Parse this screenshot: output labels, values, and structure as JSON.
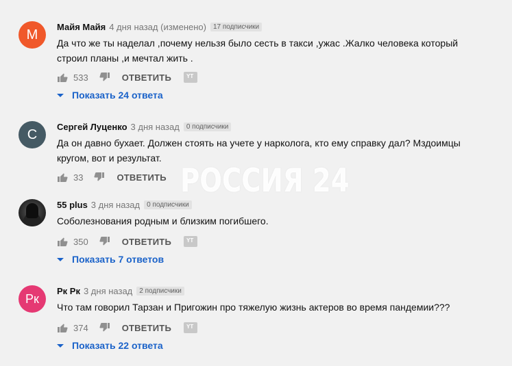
{
  "comments": [
    {
      "avatar_letter": "M",
      "avatar_color": "#f0582a",
      "author": "Майя Майя",
      "time": "4 дня назад (изменено)",
      "subscribers": "17 подписчики",
      "text_lines": [
        "Да что же  ты наделал ,почему нельзя было сесть в такси ,ужас .Жалко человека который",
        "строил планы ,и мечтал жить ."
      ],
      "likes": "533",
      "reply_label": "ОТВЕТИТЬ",
      "show_replies": "Показать 24 ответа"
    },
    {
      "avatar_letter": "С",
      "avatar_color": "#455a64",
      "author": "Сергей Луценко",
      "time": "3 дня назад",
      "subscribers": "0 подписчики",
      "text_lines": [
        "Да он давно бухает. Должен стоять на учете у нарколога, кто ему справку дал? Мздоимцы",
        "кругом, вот и результат."
      ],
      "likes": "33",
      "reply_label": "ОТВЕТИТЬ"
    },
    {
      "avatar_letter": "",
      "author": "55 plus",
      "time": "3 дня назад",
      "subscribers": "0 подписчики",
      "text_lines": [
        "Соболезнования родным и близким погибшего."
      ],
      "likes": "350",
      "reply_label": "ОТВЕТИТЬ",
      "show_replies": "Показать 7 ответов"
    },
    {
      "avatar_letter": "Рк",
      "avatar_color": "#e53973",
      "author": "Рк Рк",
      "time": "3 дня назад",
      "subscribers": "2 подписчики",
      "text_lines": [
        "Что там говорил Тарзан и Пригожин про тяжелую жизнь актеров во время пандемии???"
      ],
      "likes": "374",
      "reply_label": "ОТВЕТИТЬ",
      "show_replies": "Показать 22 ответа"
    }
  ],
  "watermark": "РОССИЯ 24",
  "tag_text": "YT"
}
